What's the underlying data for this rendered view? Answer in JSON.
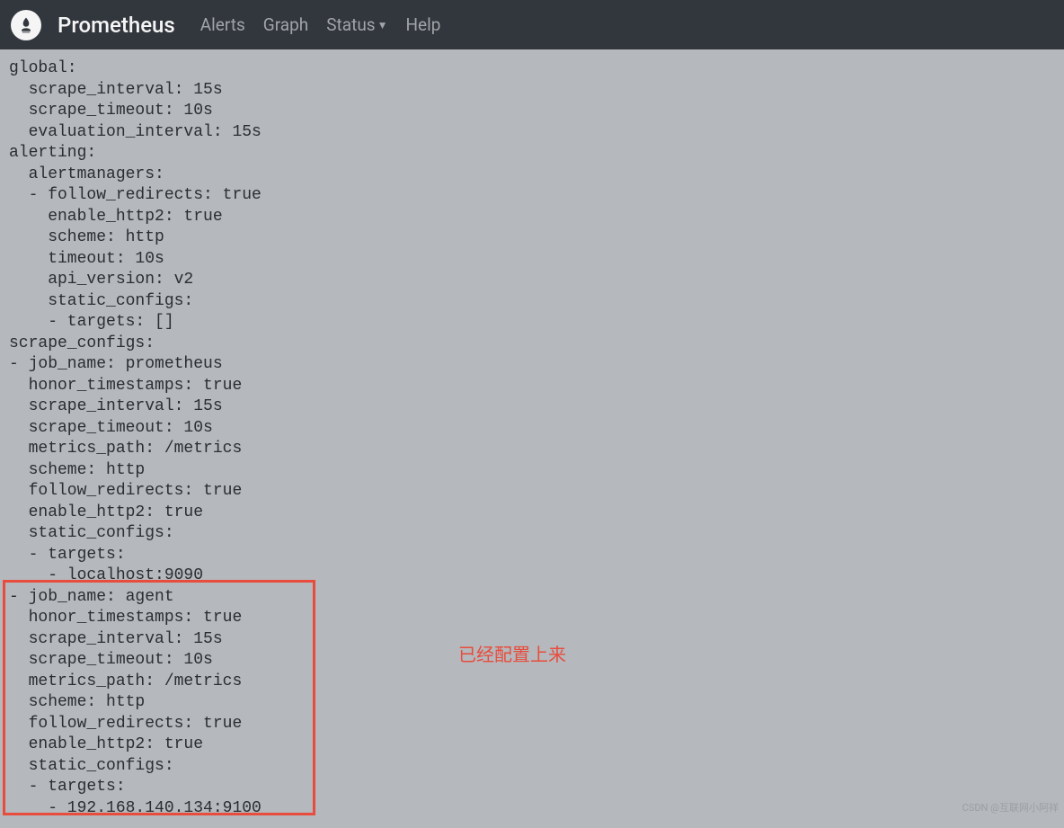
{
  "navbar": {
    "brand": "Prometheus",
    "links": {
      "alerts": "Alerts",
      "graph": "Graph",
      "status": "Status",
      "help": "Help"
    }
  },
  "config": {
    "line1": "global:",
    "line2": "  scrape_interval: 15s",
    "line3": "  scrape_timeout: 10s",
    "line4": "  evaluation_interval: 15s",
    "line5": "alerting:",
    "line6": "  alertmanagers:",
    "line7": "  - follow_redirects: true",
    "line8": "    enable_http2: true",
    "line9": "    scheme: http",
    "line10": "    timeout: 10s",
    "line11": "    api_version: v2",
    "line12": "    static_configs:",
    "line13": "    - targets: []",
    "line14": "scrape_configs:",
    "line15": "- job_name: prometheus",
    "line16": "  honor_timestamps: true",
    "line17": "  scrape_interval: 15s",
    "line18": "  scrape_timeout: 10s",
    "line19": "  metrics_path: /metrics",
    "line20": "  scheme: http",
    "line21": "  follow_redirects: true",
    "line22": "  enable_http2: true",
    "line23": "  static_configs:",
    "line24": "  - targets:",
    "line25": "    - localhost:9090",
    "line26": "- job_name: agent",
    "line27": "  honor_timestamps: true",
    "line28": "  scrape_interval: 15s",
    "line29": "  scrape_timeout: 10s",
    "line30": "  metrics_path: /metrics",
    "line31": "  scheme: http",
    "line32": "  follow_redirects: true",
    "line33": "  enable_http2: true",
    "line34": "  static_configs:",
    "line35": "  - targets:",
    "line36": "    - 192.168.140.134:9100"
  },
  "annotation": "已经配置上来",
  "watermark": "CSDN @互联网小阿祥"
}
